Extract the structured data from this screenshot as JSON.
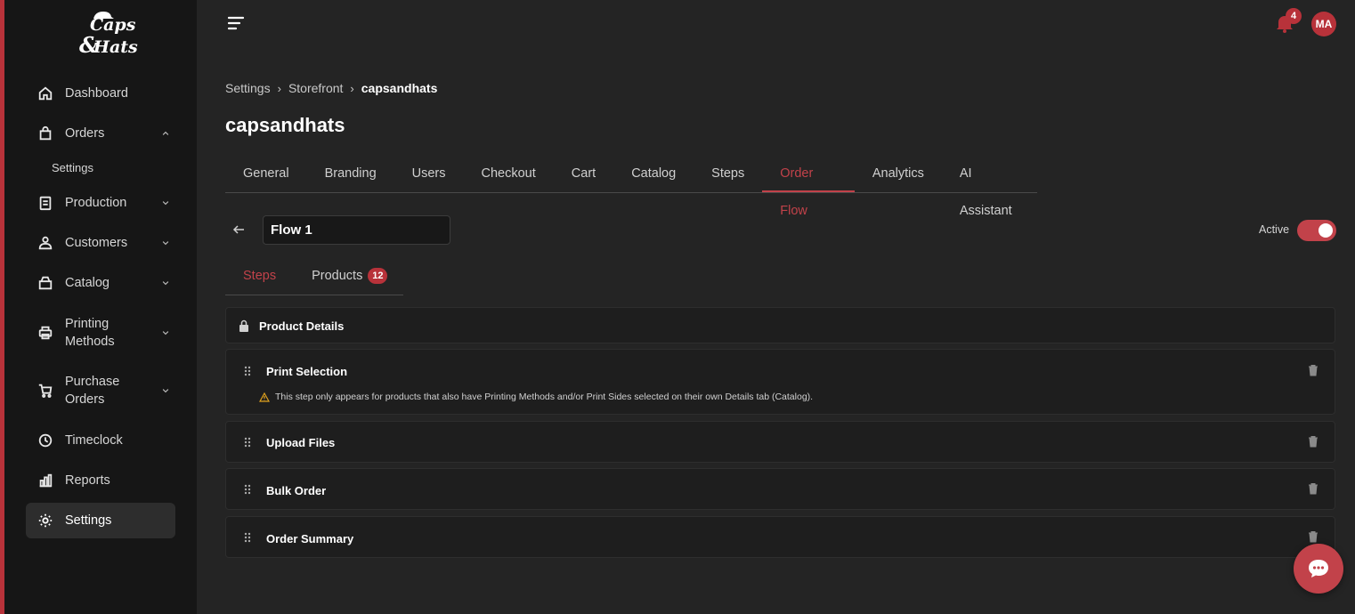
{
  "brand": {
    "logo_line1": "Caps",
    "logo_amp": "&",
    "logo_line2": "Hats",
    "accent": "#b8323a"
  },
  "sidebar": {
    "items": [
      {
        "label": "Dashboard",
        "icon": "home-icon"
      },
      {
        "label": "Orders",
        "icon": "shopping-bag-icon",
        "expanded": true
      },
      {
        "label": "Production",
        "icon": "clipboard-icon"
      },
      {
        "label": "Customers",
        "icon": "users-icon"
      },
      {
        "label": "Catalog",
        "icon": "box-icon"
      },
      {
        "label": "Printing Methods",
        "icon": "printer-icon"
      },
      {
        "label": "Purchase Orders",
        "icon": "cart-icon"
      },
      {
        "label": "Timeclock",
        "icon": "clock-icon"
      },
      {
        "label": "Reports",
        "icon": "bar-chart-icon"
      },
      {
        "label": "Settings",
        "icon": "gear-icon",
        "active": true
      }
    ],
    "orders_sub": "Settings"
  },
  "header": {
    "notifications_count": "4",
    "avatar_initials": "MA"
  },
  "breadcrumb": {
    "items": [
      "Settings",
      "Storefront",
      "capsandhats"
    ]
  },
  "page": {
    "title": "capsandhats"
  },
  "tabs": [
    "General",
    "Branding",
    "Users",
    "Checkout",
    "Cart",
    "Catalog",
    "Steps",
    "Order Flow",
    "Analytics",
    "AI Assistant"
  ],
  "active_tab": "Order Flow",
  "flow": {
    "name": "Flow 1",
    "active_label": "Active",
    "active": true
  },
  "subtabs": {
    "steps": "Steps",
    "products": "Products",
    "products_count": "12"
  },
  "steps": [
    {
      "title": "Product Details",
      "locked": true
    },
    {
      "title": "Print Selection",
      "warning": "This step only appears for products that also have Printing Methods and/or Print Sides selected on their own Details tab (Catalog)."
    },
    {
      "title": "Upload Files"
    },
    {
      "title": "Bulk Order"
    },
    {
      "title": "Order Summary"
    }
  ]
}
